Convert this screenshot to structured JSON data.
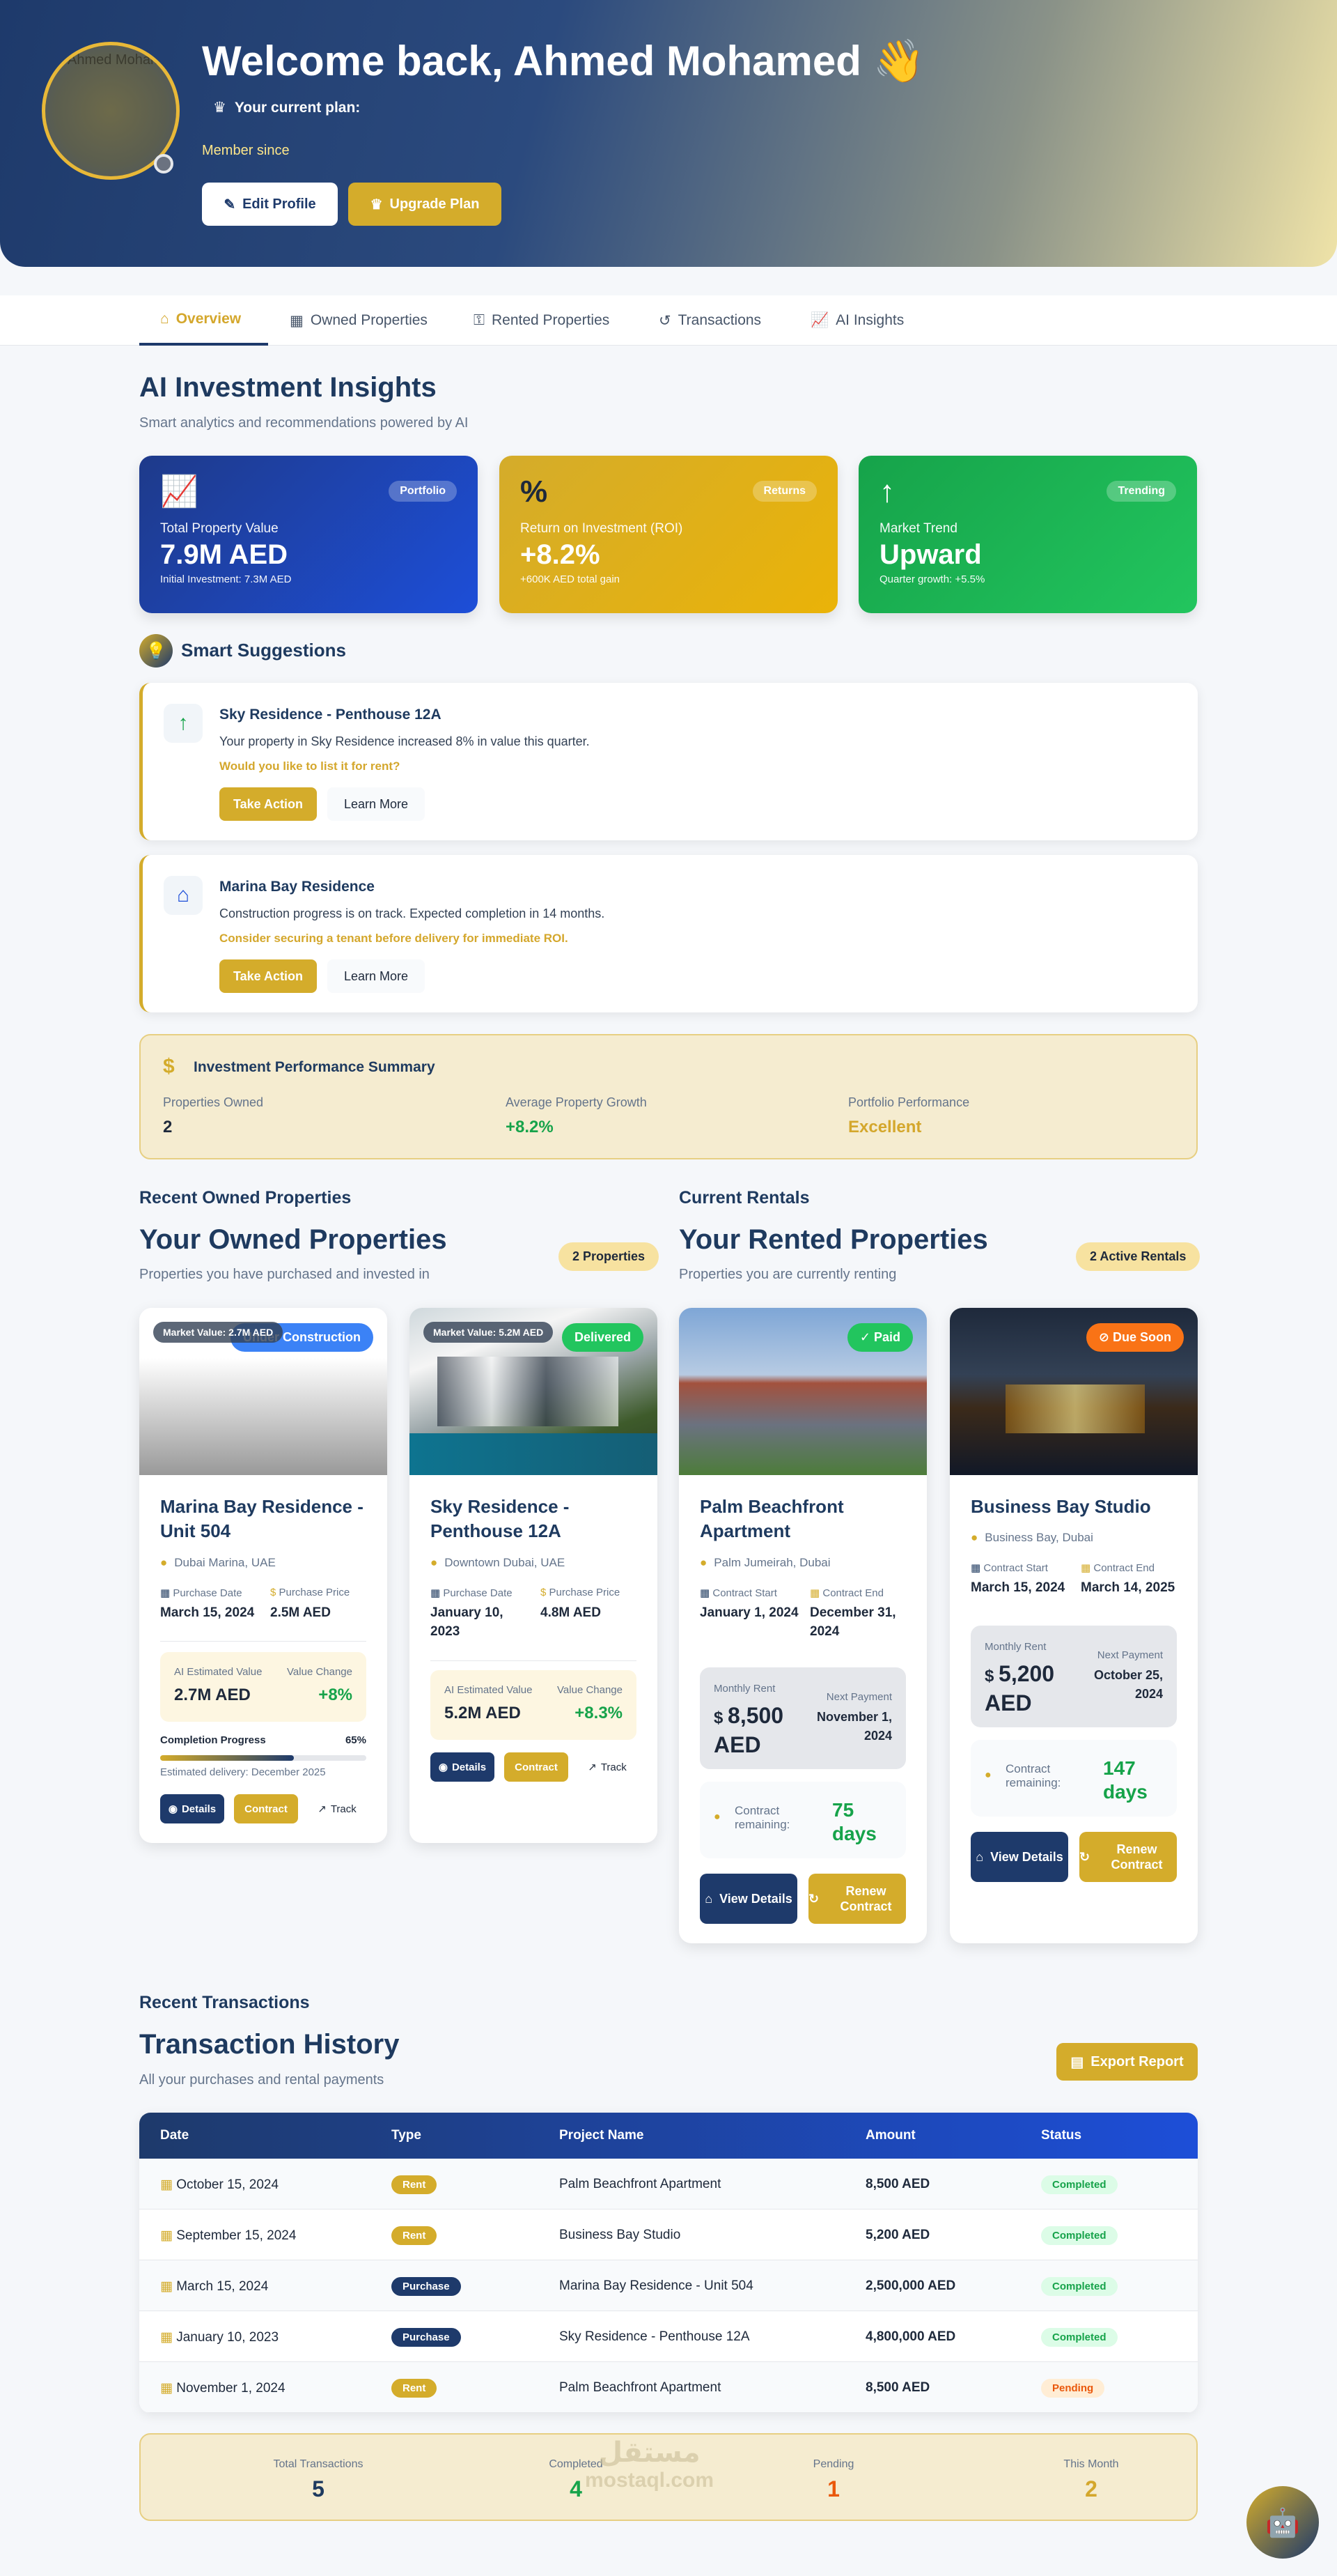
{
  "hero": {
    "avatar_text": "Ahmed Mohamed",
    "welcome": "Welcome back, Ahmed Mohamed 👋",
    "plan_label": "Your current plan:",
    "member_since": "Member since",
    "edit_profile": "Edit Profile",
    "upgrade_plan": "Upgrade Plan"
  },
  "tabs": [
    "Overview",
    "Owned Properties",
    "Rented Properties",
    "Transactions",
    "AI Insights"
  ],
  "insights": {
    "title": "AI Investment Insights",
    "subtitle": "Smart analytics and recommendations powered by AI",
    "cards": [
      {
        "pill": "Portfolio",
        "label": "Total Property Value",
        "value": "7.9M AED",
        "note": "Initial Investment: 7.3M AED",
        "icon": "chart-line-icon",
        "color_from": "#1e3a8a",
        "color_to": "#1d4ed8"
      },
      {
        "pill": "Returns",
        "label": "Return on Investment (ROI)",
        "value": "+8.2%",
        "note": "+600K AED total gain",
        "icon": "percent-icon",
        "color_from": "#d4ac2b",
        "color_to": "#eab308"
      },
      {
        "pill": "Trending",
        "label": "Market Trend",
        "value": "Upward",
        "note": "Quarter growth: +5.5%",
        "icon": "arrow-up-icon",
        "color_from": "#16a34a",
        "color_to": "#22c55e"
      }
    ]
  },
  "suggestions": {
    "title": "Smart Suggestions",
    "items": [
      {
        "title": "Sky Residence - Penthouse 12A",
        "desc": "Your property in Sky Residence increased 8% in value this quarter.",
        "question": "Would you like to list it for rent?",
        "action": "Take Action",
        "learn": "Learn More",
        "icon": "arrow-up-icon"
      },
      {
        "title": "Marina Bay Residence",
        "desc": "Construction progress is on track. Expected completion in 14 months.",
        "question": "Consider securing a tenant before delivery for immediate ROI.",
        "action": "Take Action",
        "learn": "Learn More",
        "icon": "home-icon"
      }
    ]
  },
  "performance": {
    "title": "Investment Performance Summary",
    "items": [
      {
        "label": "Properties Owned",
        "value": "2",
        "color": "#1e293b"
      },
      {
        "label": "Average Property Growth",
        "value": "+8.2%",
        "color": "#16a34a"
      },
      {
        "label": "Portfolio Performance",
        "value": "Excellent",
        "color": "#d4a72c"
      }
    ]
  },
  "owned": {
    "section": "Recent Owned Properties",
    "title": "Your Owned Properties",
    "subtitle": "Properties you have purchased and invested in",
    "count": "2 Properties",
    "cards": [
      {
        "market": "Market Value: 2.7M AED",
        "status": "Under Construction",
        "name": "Marina Bay Residence - Unit 504",
        "location": "Dubai Marina, UAE",
        "purchase_date_label": "Purchase Date",
        "purchase_date": "March 15, 2024",
        "price_label": "Purchase Price",
        "price": "2.5M AED",
        "ai_label": "AI Estimated Value",
        "ai_value": "2.7M AED",
        "change_label": "Value Change",
        "change": "+8%",
        "progress_label": "Completion Progress",
        "progress": "65%",
        "progress_value": 0.65,
        "delivery": "Estimated delivery: December 2025",
        "details": "Details",
        "contract": "Contract",
        "track": "Track"
      },
      {
        "market": "Market Value: 5.2M AED",
        "status": "Delivered",
        "name": "Sky Residence - Penthouse 12A",
        "location": "Downtown Dubai, UAE",
        "purchase_date_label": "Purchase Date",
        "purchase_date": "January 10, 2023",
        "price_label": "Purchase Price",
        "price": "4.8M AED",
        "ai_label": "AI Estimated Value",
        "ai_value": "5.2M AED",
        "change_label": "Value Change",
        "change": "+8.3%",
        "details": "Details",
        "contract": "Contract",
        "track": "Track"
      }
    ]
  },
  "rented": {
    "section": "Current Rentals",
    "title": "Your Rented Properties",
    "subtitle": "Properties you are currently renting",
    "count": "2 Active Rentals",
    "cards": [
      {
        "status": "Paid",
        "name": "Palm Beachfront Apartment",
        "location": "Palm Jumeirah, Dubai",
        "start_label": "Contract Start",
        "start": "January 1, 2024",
        "end_label": "Contract End",
        "end": "December 31, 2024",
        "rent_label": "Monthly Rent",
        "rent": "8,500 AED",
        "next_label": "Next Payment",
        "next": "November 1, 2024",
        "remain_label": "Contract remaining:",
        "remain": "75 days",
        "view": "View Details",
        "renew": "Renew Contract"
      },
      {
        "status": "Due Soon",
        "name": "Business Bay Studio",
        "location": "Business Bay, Dubai",
        "start_label": "Contract Start",
        "start": "March 15, 2024",
        "end_label": "Contract End",
        "end": "March 14, 2025",
        "rent_label": "Monthly Rent",
        "rent": "5,200 AED",
        "next_label": "Next Payment",
        "next": "October 25, 2024",
        "remain_label": "Contract remaining:",
        "remain": "147 days",
        "view": "View Details",
        "renew": "Renew Contract"
      }
    ]
  },
  "transactions": {
    "section": "Recent Transactions",
    "title": "Transaction History",
    "subtitle": "All your purchases and rental payments",
    "export": "Export Report",
    "columns": [
      "Date",
      "Type",
      "Project Name",
      "Amount",
      "Status"
    ],
    "rows": [
      {
        "date": "October 15, 2024",
        "type": "Rent",
        "project": "Palm Beachfront Apartment",
        "amount": "8,500 AED",
        "status": "Completed"
      },
      {
        "date": "September 15, 2024",
        "type": "Rent",
        "project": "Business Bay Studio",
        "amount": "5,200 AED",
        "status": "Completed"
      },
      {
        "date": "March 15, 2024",
        "type": "Purchase",
        "project": "Marina Bay Residence - Unit 504",
        "amount": "2,500,000 AED",
        "status": "Completed"
      },
      {
        "date": "January 10, 2023",
        "type": "Purchase",
        "project": "Sky Residence - Penthouse 12A",
        "amount": "4,800,000 AED",
        "status": "Completed"
      },
      {
        "date": "November 1, 2024",
        "type": "Rent",
        "project": "Palm Beachfront Apartment",
        "amount": "8,500 AED",
        "status": "Pending"
      }
    ],
    "summary": [
      {
        "label": "Total Transactions",
        "value": "5",
        "color": "#1e3a5f"
      },
      {
        "label": "Completed",
        "value": "4",
        "color": "#16a34a"
      },
      {
        "label": "Pending",
        "value": "1",
        "color": "#ea580c"
      },
      {
        "label": "This Month",
        "value": "2",
        "color": "#d4a72c"
      }
    ]
  },
  "watermark": {
    "arabic": "مستقل",
    "latin": "mostaql.com"
  }
}
